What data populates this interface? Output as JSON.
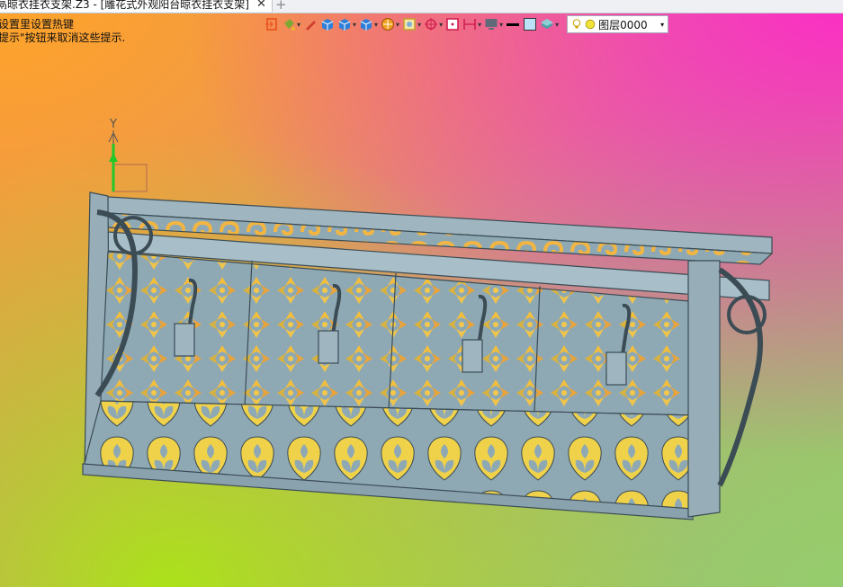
{
  "tab": {
    "title": "鬲晾衣挂衣支架.Z3 - [雕花式外观阳台晾衣挂衣支架]",
    "close": "✕",
    "add": "+"
  },
  "hints": [
    "设置里设置热键",
    "提示\"按钮来取消这些提示."
  ],
  "toolbar": {
    "buttons": [
      {
        "icon": "exit-icon",
        "color": "#e8501c",
        "caret": false
      },
      {
        "icon": "paint-bucket-icon",
        "color": "#7fa832",
        "caret": true
      },
      {
        "icon": "pencil-icon",
        "color": "#d04030",
        "caret": false
      },
      {
        "icon": "box-solid-icon",
        "color": "#2f7fd8",
        "caret": false
      },
      {
        "icon": "cube-icon",
        "color": "#2f7fd8",
        "caret": true
      },
      {
        "icon": "view-cube-icon",
        "color": "#2f7fd8",
        "caret": true
      },
      {
        "icon": "render-ball-icon",
        "color": "#f0a020",
        "caret": true
      },
      {
        "icon": "frame-icon",
        "color": "#c8a030",
        "caret": true
      },
      {
        "icon": "crosshair-icon",
        "color": "#d02050",
        "caret": true
      },
      {
        "icon": "snap-box-icon",
        "color": "#d02050",
        "caret": false
      },
      {
        "icon": "dimension-icon",
        "color": "#d02050",
        "caret": true
      },
      {
        "icon": "display-icon",
        "color": "#606a78",
        "caret": true
      },
      {
        "icon": "line-weight-icon",
        "color": "#000000",
        "caret": false
      },
      {
        "icon": "color-swatch-icon",
        "color": "#bde1f7",
        "caret": false
      },
      {
        "icon": "layer-stack-icon",
        "color": "#4aa0a8",
        "caret": true
      }
    ],
    "layer": {
      "name": "图层0000",
      "caret": "▾"
    }
  },
  "axis": {
    "label": "Y"
  },
  "colors": {
    "model": "#8fa9b4",
    "model_dark": "#3b4c55",
    "accent_green": "#22c82a"
  }
}
